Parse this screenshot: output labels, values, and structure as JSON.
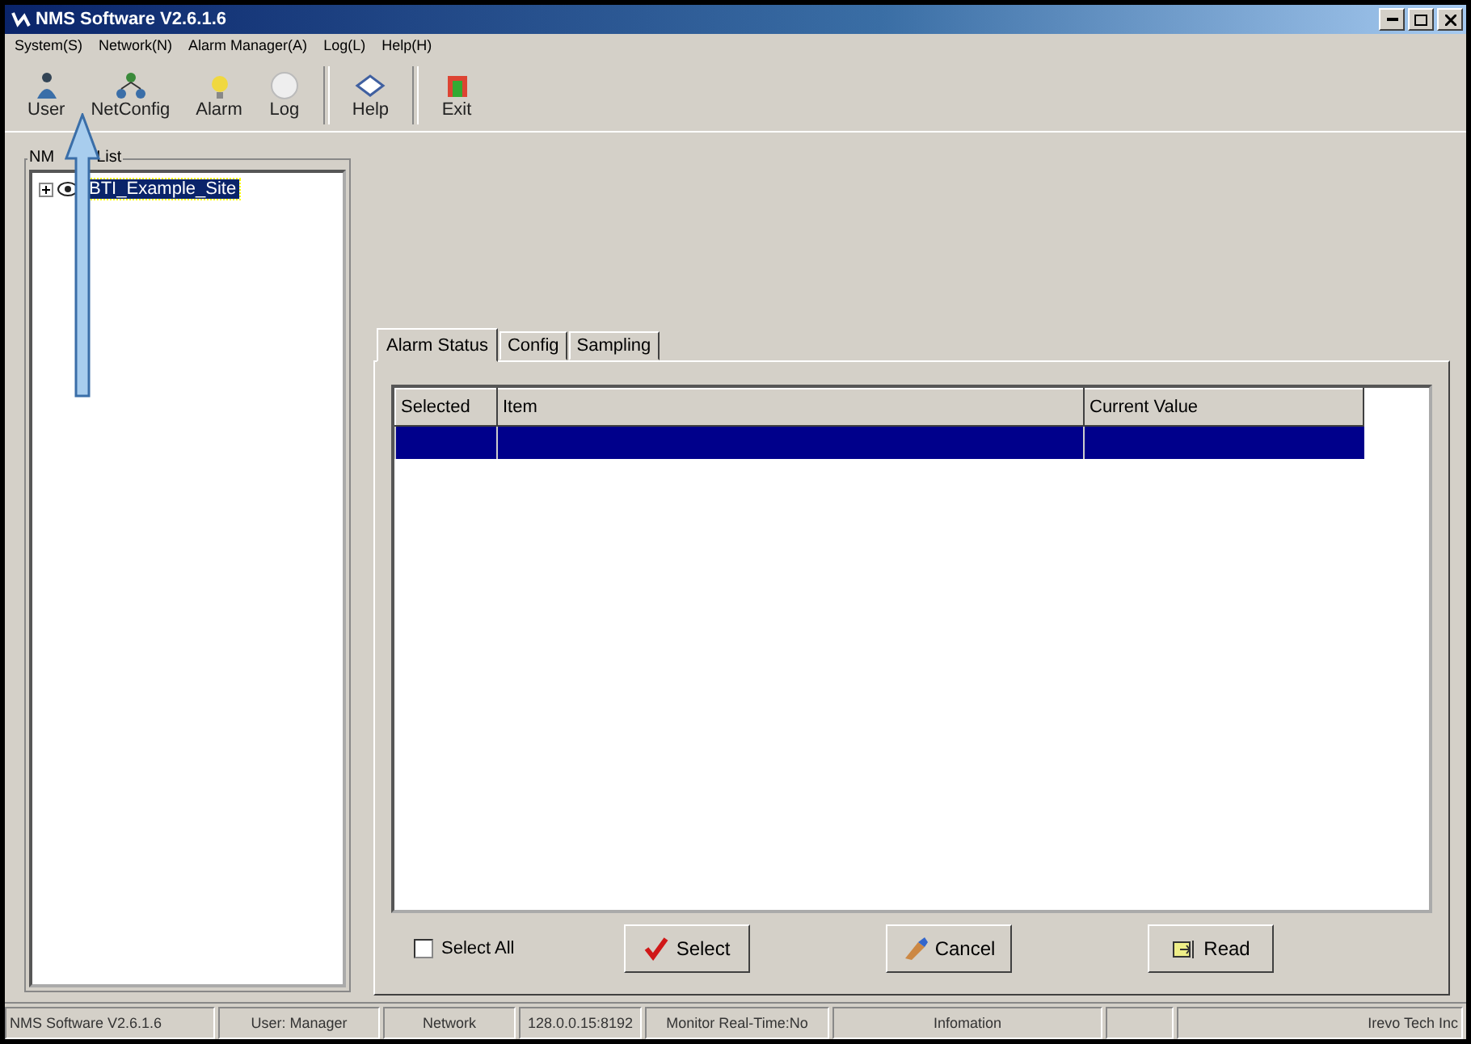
{
  "window": {
    "title": "NMS Software V2.6.1.6"
  },
  "menu": [
    "System(S)",
    "Network(N)",
    "Alarm Manager(A)",
    "Log(L)",
    "Help(H)"
  ],
  "toolbar_groups": [
    {
      "buttons": [
        {
          "label": "User",
          "kind": "user"
        },
        {
          "label": "NetConfig",
          "kind": "network"
        },
        {
          "label": "Alarm",
          "kind": "alarm"
        },
        {
          "label": "Log",
          "kind": "log"
        }
      ]
    },
    {
      "buttons": [
        {
          "label": "Help",
          "kind": "help"
        }
      ]
    },
    {
      "buttons": [
        {
          "label": "Exit",
          "kind": "exit"
        }
      ]
    }
  ],
  "nms_list": {
    "title_left": "NM",
    "title_right": "List",
    "items": [
      {
        "label": "BTI_Example_Site",
        "expanded": false,
        "selected": true
      }
    ]
  },
  "tabs": [
    {
      "label": "Alarm Status",
      "selected": true
    },
    {
      "label": "Config",
      "selected": false
    },
    {
      "label": "Sampling",
      "selected": false
    }
  ],
  "table": {
    "columns": [
      "Selected",
      "Item",
      "Current Value"
    ],
    "rows": [
      {
        "selected": true
      }
    ]
  },
  "select_all": {
    "label": "Select All",
    "checked": false
  },
  "buttons": [
    {
      "label": "Select",
      "kind": "check"
    },
    {
      "label": "Cancel",
      "kind": "cancel"
    },
    {
      "label": "Read",
      "kind": "read"
    }
  ],
  "status_bar": [
    "NMS Software V2.6.1.6",
    "User: Manager",
    "Network",
    "128.0.0.15:8192",
    "Monitor Real-Time:No",
    "Infomation",
    "Irevo Tech Inc"
  ]
}
